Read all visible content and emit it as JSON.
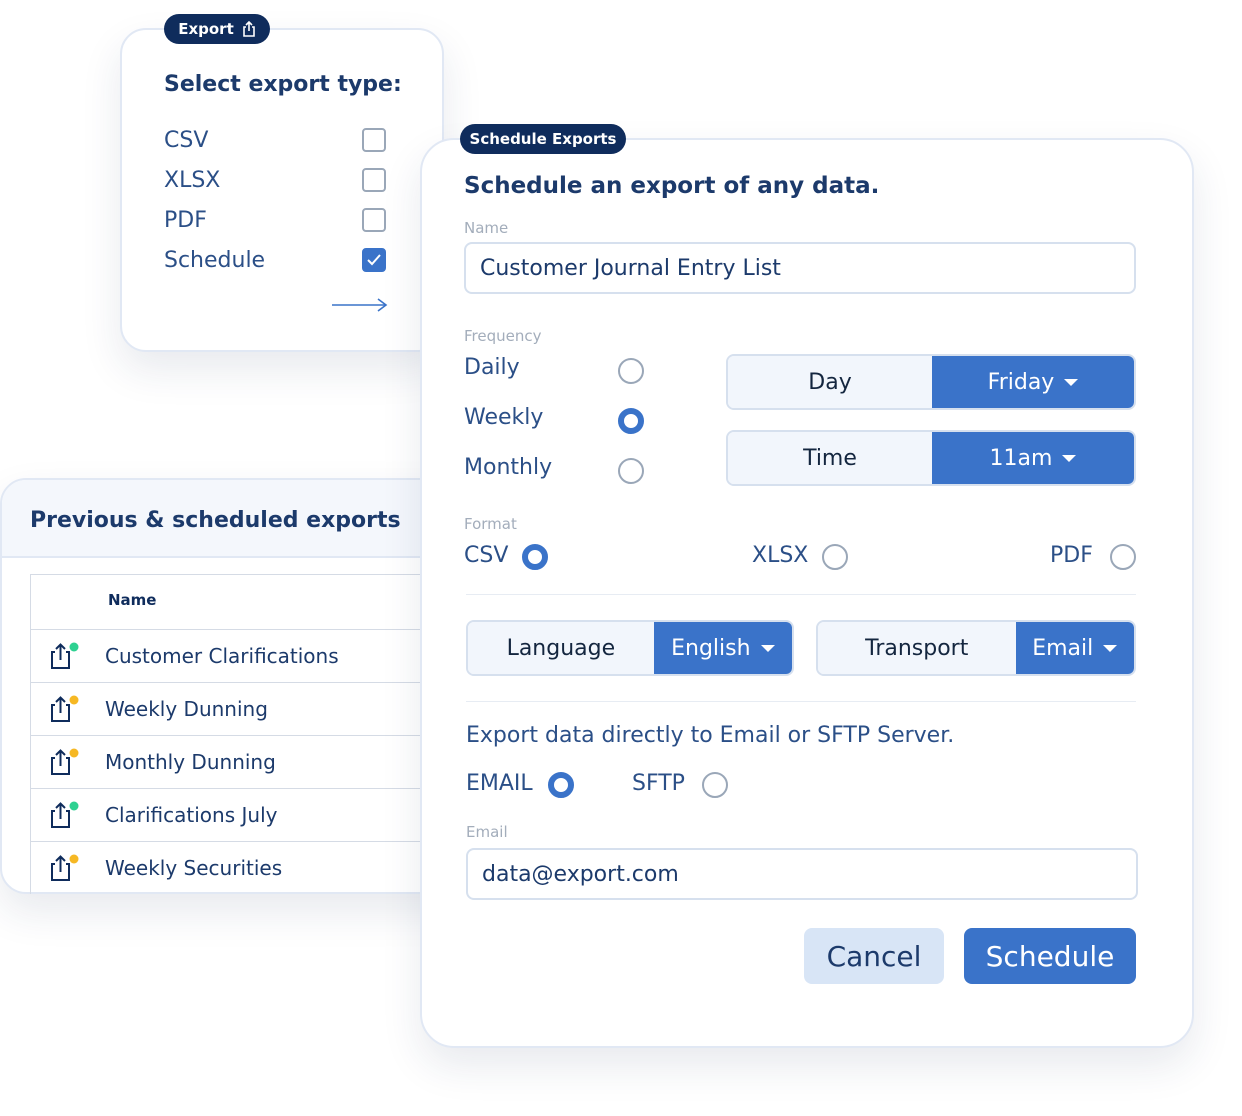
{
  "export_card": {
    "pill_label": "Export",
    "title": "Select export type:",
    "options": [
      {
        "label": "CSV",
        "checked": false
      },
      {
        "label": "XLSX",
        "checked": false
      },
      {
        "label": "PDF",
        "checked": false
      },
      {
        "label": "Schedule",
        "checked": true
      }
    ]
  },
  "previous_exports": {
    "title": "Previous & scheduled exports",
    "column_name": "Name",
    "rows": [
      {
        "name": "Customer Clarifications",
        "status_color": "#2ed191"
      },
      {
        "name": "Weekly Dunning",
        "status_color": "#f6b824"
      },
      {
        "name": "Monthly Dunning",
        "status_color": "#f6b824"
      },
      {
        "name": "Clarifications July",
        "status_color": "#2ed191"
      },
      {
        "name": "Weekly Securities",
        "status_color": "#f6b824"
      }
    ]
  },
  "schedule": {
    "pill_label": "Schedule Exports",
    "title": "Schedule an export of any data.",
    "name_label": "Name",
    "name_value": "Customer Journal Entry List",
    "frequency_label": "Frequency",
    "frequency_options": [
      {
        "label": "Daily",
        "selected": false
      },
      {
        "label": "Weekly",
        "selected": true
      },
      {
        "label": "Monthly",
        "selected": false
      }
    ],
    "day": {
      "label": "Day",
      "value": "Friday"
    },
    "time": {
      "label": "Time",
      "value": "11am"
    },
    "format_label": "Format",
    "format_options": [
      {
        "label": "CSV",
        "selected": true
      },
      {
        "label": "XLSX",
        "selected": false
      },
      {
        "label": "PDF",
        "selected": false
      }
    ],
    "language": {
      "label": "Language",
      "value": "English"
    },
    "transport": {
      "label": "Transport",
      "value": "Email"
    },
    "export_note": "Export data directly to Email or SFTP Server.",
    "transport_options": [
      {
        "label": "EMAIL",
        "selected": true
      },
      {
        "label": "SFTP",
        "selected": false
      }
    ],
    "email_label": "Email",
    "email_value": "data@export.com",
    "cancel_label": "Cancel",
    "schedule_label": "Schedule"
  },
  "colors": {
    "accent": "#3a73c9",
    "navy": "#0f2c5c",
    "status_green": "#2ed191",
    "status_yellow": "#f6b824"
  }
}
